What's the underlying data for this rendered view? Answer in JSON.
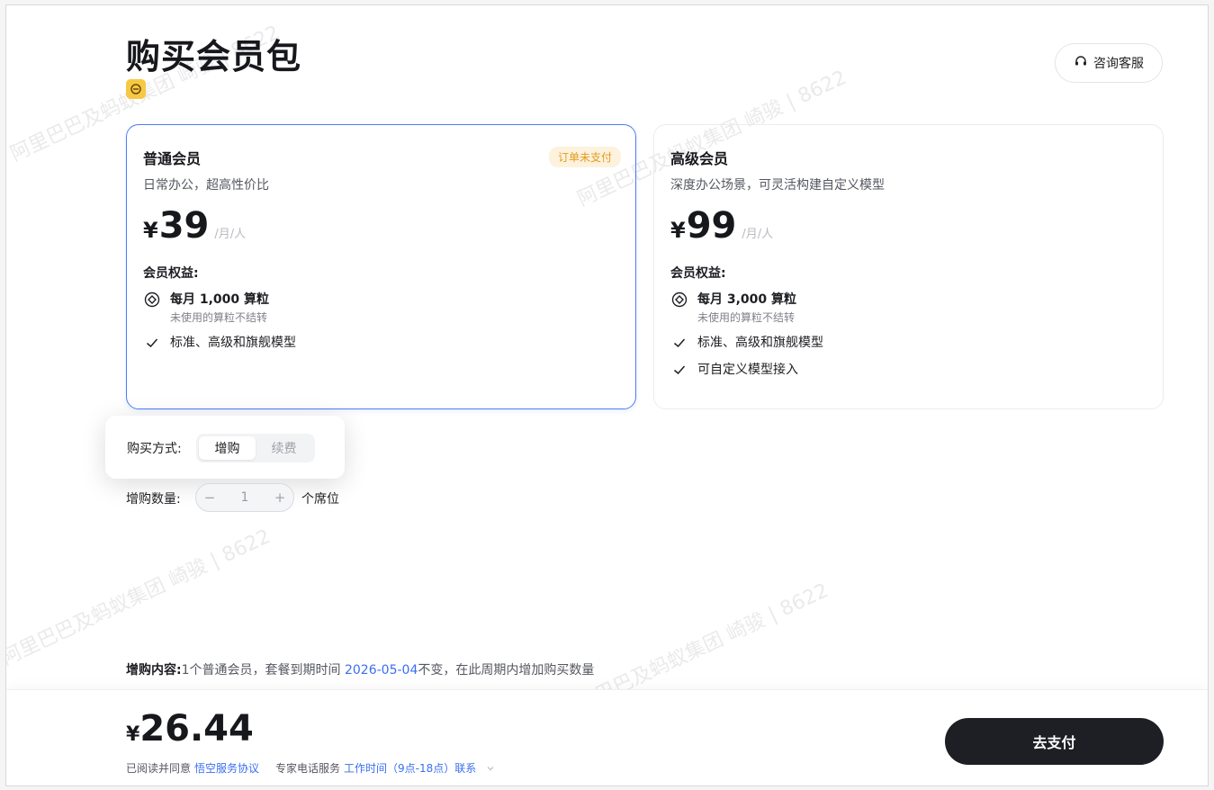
{
  "page": {
    "title": "购买会员包",
    "support_label": "咨询客服"
  },
  "plans": [
    {
      "name": "普通会员",
      "desc": "日常办公，超高性价比",
      "price_symbol": "¥",
      "price": "39",
      "unit": "/月/人",
      "benefits_title": "会员权益:",
      "tag": "订单未支付",
      "benefits": [
        {
          "icon": "coin-icon",
          "main": "每月 1,000 算粒",
          "note": "未使用的算粒不结转"
        },
        {
          "icon": "check-icon",
          "text": "标准、高级和旗舰模型"
        }
      ]
    },
    {
      "name": "高级会员",
      "desc": "深度办公场景，可灵活构建自定义模型",
      "price_symbol": "¥",
      "price": "99",
      "unit": "/月/人",
      "benefits_title": "会员权益:",
      "benefits": [
        {
          "icon": "coin-icon",
          "main": "每月 3,000 算粒",
          "note": "未使用的算粒不结转"
        },
        {
          "icon": "check-icon",
          "text": "标准、高级和旗舰模型"
        },
        {
          "icon": "check-icon",
          "text": "可自定义模型接入"
        }
      ]
    }
  ],
  "purchase": {
    "method_label": "购买方式:",
    "method_options": [
      "增购",
      "续费"
    ],
    "selected_method": "增购",
    "qty_label": "增购数量:",
    "qty_minus": "−",
    "qty_value": "1",
    "qty_plus": "+",
    "qty_unit": "个席位"
  },
  "summary": {
    "prefix": "增购内容:",
    "text1": "1个普通会员，套餐到期时间",
    "date": "2026-05-04",
    "text2": "不变，在此周期内增加购买数量"
  },
  "footer": {
    "currency": "¥",
    "total": "26.44",
    "agree_text": "已阅读并同意",
    "agreement_link": "悟空服务协议",
    "phone_text": "专家电话服务",
    "hours_link": "工作时间（9点-18点）联系",
    "pay_label": "去支付"
  },
  "watermark": {
    "text": "阿里巴巴及蚂蚁集团 崎骏 | 8622"
  },
  "colors": {
    "accent": "#4d7df5",
    "link": "#3a6ff0",
    "tag_bg": "#fdf2dd",
    "tag_text": "#e39a1c",
    "pay_bg": "#1e1f24"
  }
}
